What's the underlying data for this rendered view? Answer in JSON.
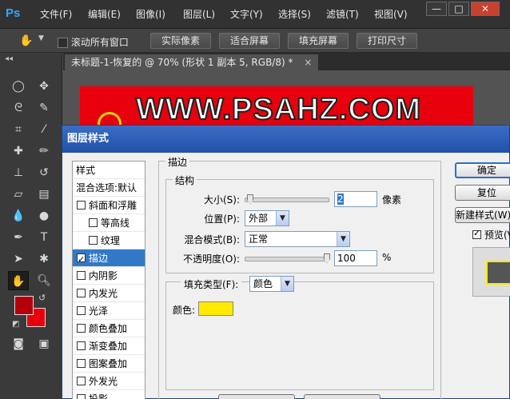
{
  "menubar": {
    "logo": "Ps",
    "items": [
      "文件(F)",
      "编辑(E)",
      "图像(I)",
      "图层(L)",
      "文字(Y)",
      "选择(S)",
      "滤镜(T)",
      "视图(V)"
    ],
    "minimize": "—",
    "maximize": "□",
    "close": "✕"
  },
  "options": {
    "scroll_all_label": "滚动所有窗口",
    "actual_pixels": "实际像素",
    "fit_screen": "适合屏幕",
    "fill_screen": "填充屏幕",
    "print_size": "打印尺寸"
  },
  "document": {
    "tab_label": "未标题-1-恢复的 @ 70% (形状 1 副本 5, RGB/8) *",
    "tab_close": "×",
    "canvas_text": "WWW.PSAHZ.COM"
  },
  "colors": {
    "foreground": "#b3000b",
    "background": "#e8000d",
    "canvas": "#e8000d",
    "stroke": "#ffea00",
    "selected_item": "#3179c8"
  },
  "dialog": {
    "title": "图层样式",
    "styles_header": "样式",
    "blend_options": "混合选项:默认",
    "style_items": [
      {
        "label": "斜面和浮雕",
        "checked": false,
        "sub": false
      },
      {
        "label": "等高线",
        "checked": false,
        "sub": true
      },
      {
        "label": "纹理",
        "checked": false,
        "sub": true
      },
      {
        "label": "描边",
        "checked": true,
        "sub": false,
        "selected": true
      },
      {
        "label": "内阴影",
        "checked": false,
        "sub": false
      },
      {
        "label": "内发光",
        "checked": false,
        "sub": false
      },
      {
        "label": "光泽",
        "checked": false,
        "sub": false
      },
      {
        "label": "颜色叠加",
        "checked": false,
        "sub": false
      },
      {
        "label": "渐变叠加",
        "checked": false,
        "sub": false
      },
      {
        "label": "图案叠加",
        "checked": false,
        "sub": false
      },
      {
        "label": "外发光",
        "checked": false,
        "sub": false
      },
      {
        "label": "投影",
        "checked": false,
        "sub": false
      }
    ],
    "stroke": {
      "title": "描边",
      "structure": "结构",
      "size_label": "大小(S):",
      "size_value": "2",
      "size_unit": "像素",
      "size_level": 0.02,
      "position_label": "位置(P):",
      "position_value": "外部",
      "blend_label": "混合模式(B):",
      "blend_value": "正常",
      "opacity_label": "不透明度(O):",
      "opacity_value": "100",
      "opacity_unit": "%",
      "fill_type_label": "填充类型(F):",
      "fill_type_value": "颜色",
      "color_label": "颜色:"
    },
    "buttons": {
      "ok": "确定",
      "reset": "复位",
      "new_style": "新建样式(W)...",
      "preview": "预览(V)"
    }
  }
}
